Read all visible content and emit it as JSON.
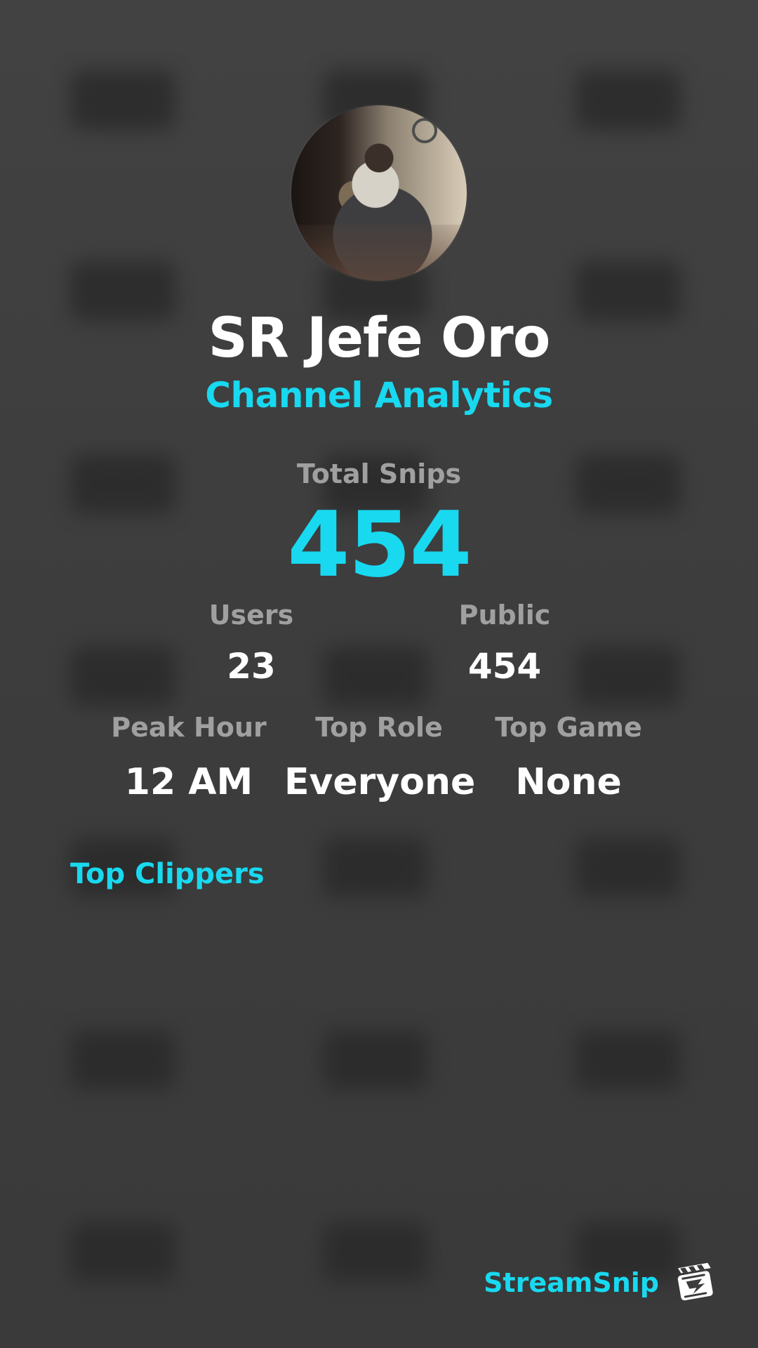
{
  "profile": {
    "name": "SR Jefe Oro",
    "subtitle": "Channel Analytics"
  },
  "stats": {
    "total_label": "Total Snips",
    "total_value": "454",
    "users_label": "Users",
    "users_value": "23",
    "public_label": "Public",
    "public_value": "454",
    "peak_hour_label": "Peak Hour",
    "peak_hour_value": "12 AM",
    "top_role_label": "Top Role",
    "top_role_value": "Everyone",
    "top_game_label": "Top Game",
    "top_game_value": "None"
  },
  "section": {
    "top_clippers": "Top Clippers"
  },
  "brand": {
    "name": "StreamSnip"
  },
  "colors": {
    "accent": "#18d9f0",
    "text": "#ffffff",
    "muted": "#a0a0a0",
    "background": "#3c3c3c"
  },
  "icons": {
    "avatar": "profile-avatar",
    "brand": "clapperboard-icon"
  }
}
